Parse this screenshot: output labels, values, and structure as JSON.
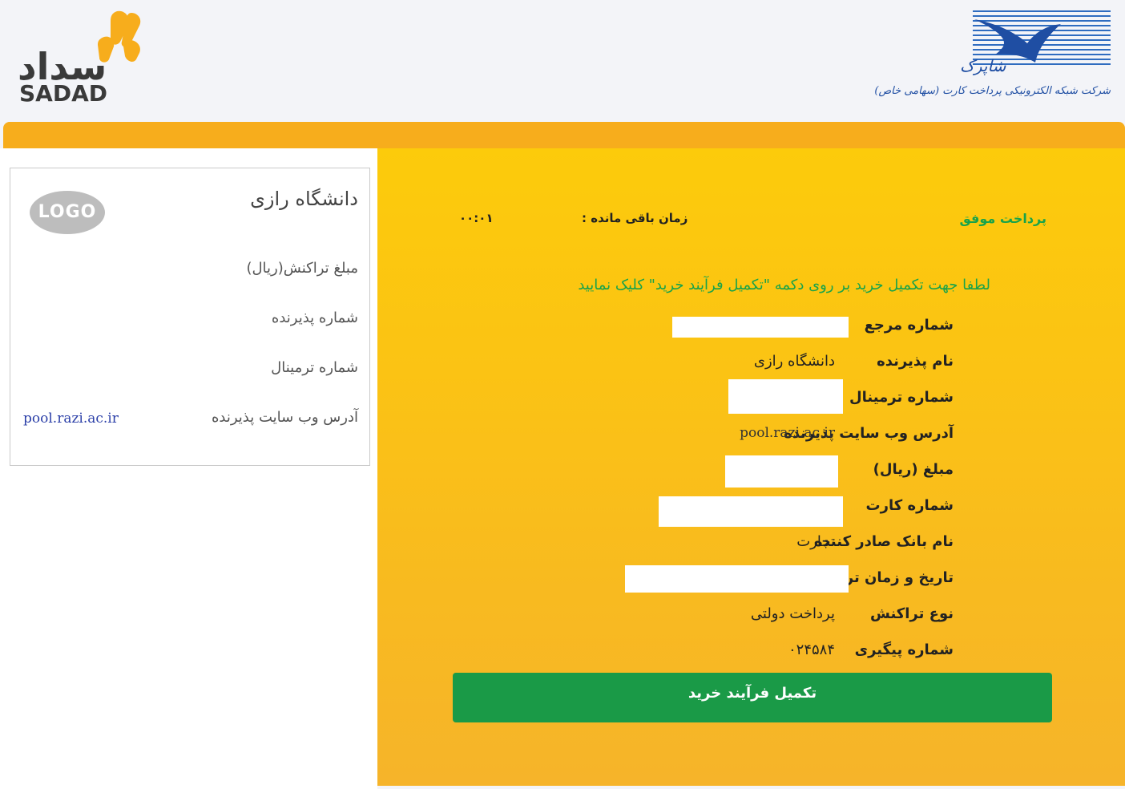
{
  "header": {
    "sadad_logo": {
      "persian_text": "سداد",
      "english_text": "SADAD",
      "accent_color": "#f7ad1c"
    },
    "shaparak_logo": {
      "brand_text": "شاپرک",
      "company_text": "شرکت شبکه الکترونیکی پرداخت کارت (سهامی خاص)",
      "color": "#1f4ea3"
    }
  },
  "left_panel": {
    "merchant_logo_text": "LOGO",
    "merchant_name": "دانشگاه رازی",
    "amount_label": "مبلغ تراکنش(ریال)",
    "acceptor_number_label": "شماره پذیرنده",
    "terminal_number_label": "شماره ترمینال",
    "website_label": "آدرس وب سایت پذیرنده",
    "website_value": "pool.razi.ac.ir"
  },
  "main": {
    "status": "پرداخت موفق",
    "time_remaining_label": "زمان باقی مانده :",
    "time_remaining_value": "۰۰:۰۱",
    "instruction": "لطفا جهت تکمیل خرید بر روی دکمه \"تکمیل فرآیند خرید\" کلیک نمایید",
    "fields": [
      {
        "label": "شماره مرجع",
        "value": ""
      },
      {
        "label": "نام پذیرنده",
        "value": "دانشگاه رازی"
      },
      {
        "label": "شماره ترمینال",
        "value": ""
      },
      {
        "label": "آدرس وب سایت پذیرنده",
        "value": "pool.razi.ac.ir"
      },
      {
        "label": "مبلغ (ریال)",
        "value": ""
      },
      {
        "label": "شماره کارت",
        "value": ""
      },
      {
        "label": "نام بانک صادر کننده",
        "value": "تجارت"
      },
      {
        "label": "تاریخ و زمان تراکنش",
        "value": ""
      },
      {
        "label": "نوع تراکنش",
        "value": "پرداخت دولتی"
      },
      {
        "label": "شماره پیگیری",
        "value": "۰۲۴۵۸۴"
      }
    ],
    "complete_button": "تکمیل فرآیند خرید",
    "colors": {
      "panel": "#fcc712",
      "success_green": "#18a34a",
      "button_green": "#1a9a47"
    }
  }
}
